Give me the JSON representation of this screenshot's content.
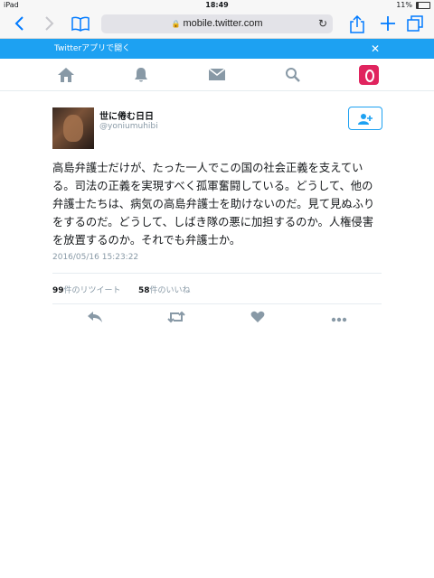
{
  "status_bar": {
    "device": "iPad",
    "time": "18:49",
    "battery": "11%"
  },
  "browser": {
    "url": "mobile.twitter.com"
  },
  "banner": {
    "text": "Twitterアプリで開く",
    "close": "✕"
  },
  "icons": {
    "nav": [
      "home-icon",
      "notifications-icon",
      "messages-icon",
      "search-icon",
      "profile-icon"
    ],
    "actions": [
      "reply-icon",
      "retweet-icon",
      "like-icon",
      "more-icon"
    ]
  },
  "tweet": {
    "display_name": "世に倦む日日",
    "screen_name": "@yoniumuhibi",
    "text_lines": [
      "高島弁護士だけが、たった一人でこの国の社会正義を支えてい",
      "る。司法の正義を実現すべく孤軍奮闘している。どうして、他の",
      "弁護士たちは、病気の高島弁護士を助けないのだ。見て見ぬふり",
      "をするのだ。どうして、しばき隊の悪に加担するのか。人権侵害",
      "を放置するのか。それでも弁護士か。"
    ],
    "timestamp": "2016/05/16 15:23:22",
    "retweet_count": "99",
    "retweet_label": "件のリツイート",
    "like_count": "58",
    "like_label": "件のいいね"
  },
  "colors": {
    "accent": "#1da1f2",
    "muted": "#8899a6",
    "profile": "#e0245e"
  }
}
